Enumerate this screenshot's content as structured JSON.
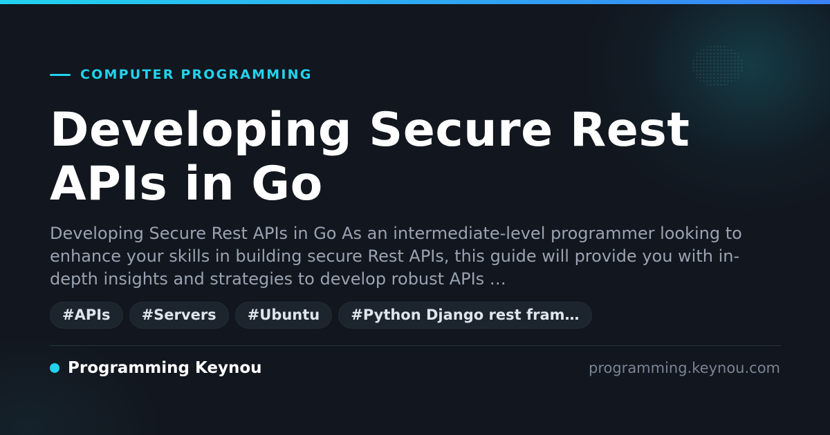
{
  "card": {
    "category": "COMPUTER PROGRAMMING",
    "title": "Developing Secure Rest APIs in Go",
    "description": "Developing Secure Rest APIs in Go As an intermediate-level programmer looking to enhance your skills in building secure Rest APIs, this guide will provide you with in-depth insights and strategies to develop robust APIs …",
    "tags": [
      "#APIs",
      "#Servers",
      "#Ubuntu",
      "#Python Django rest fram…"
    ],
    "brand_name": "Programming Keynou",
    "site_url": "programming.keynou.com"
  },
  "colors": {
    "accent": "#22d3ee",
    "accent_end": "#3b82f6",
    "background": "#12161e",
    "title": "#ffffff",
    "description": "#9aa3b2",
    "tag_background": "#1c242e",
    "muted": "#7a8494"
  },
  "icons": {
    "eyebrow": "accent-line",
    "brand": "brand-dot-icon"
  }
}
